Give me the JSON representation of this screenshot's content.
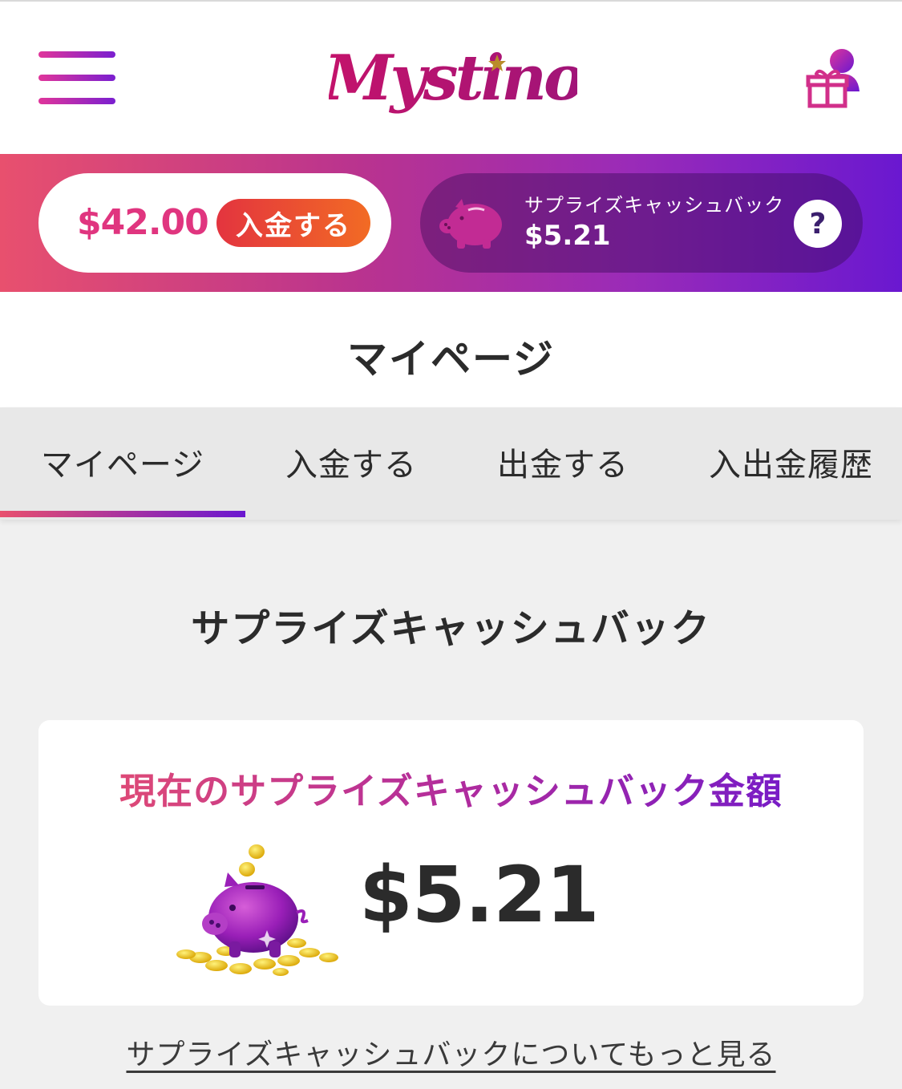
{
  "header": {
    "logo_text": "Mystino",
    "menu_icon": "hamburger-menu-icon",
    "account_icon": "user-gift-icon"
  },
  "balance_bar": {
    "balance": "$42.00",
    "deposit_label": "入金する",
    "cashback_label": "サプライズキャッシュバック",
    "cashback_value": "$5.21",
    "help_label": "?",
    "cashback_icon": "piggy-bank-icon"
  },
  "page": {
    "title": "マイページ"
  },
  "tabs": [
    {
      "label": "マイページ",
      "active": true
    },
    {
      "label": "入金する",
      "active": false
    },
    {
      "label": "出金する",
      "active": false
    },
    {
      "label": "入出金履歴",
      "active": false
    }
  ],
  "section": {
    "title": "サプライズキャッシュバック",
    "card_title": "現在のサプライズキャッシュバック金額",
    "card_amount": "$5.21",
    "card_icon": "piggy-bank-coins-icon",
    "more_link": "サプライズキャッシュバックについてもっと見る"
  },
  "colors": {
    "brand_pink": "#e0357f",
    "brand_purple": "#6a18d0",
    "deposit_orange": "#f26b24"
  }
}
